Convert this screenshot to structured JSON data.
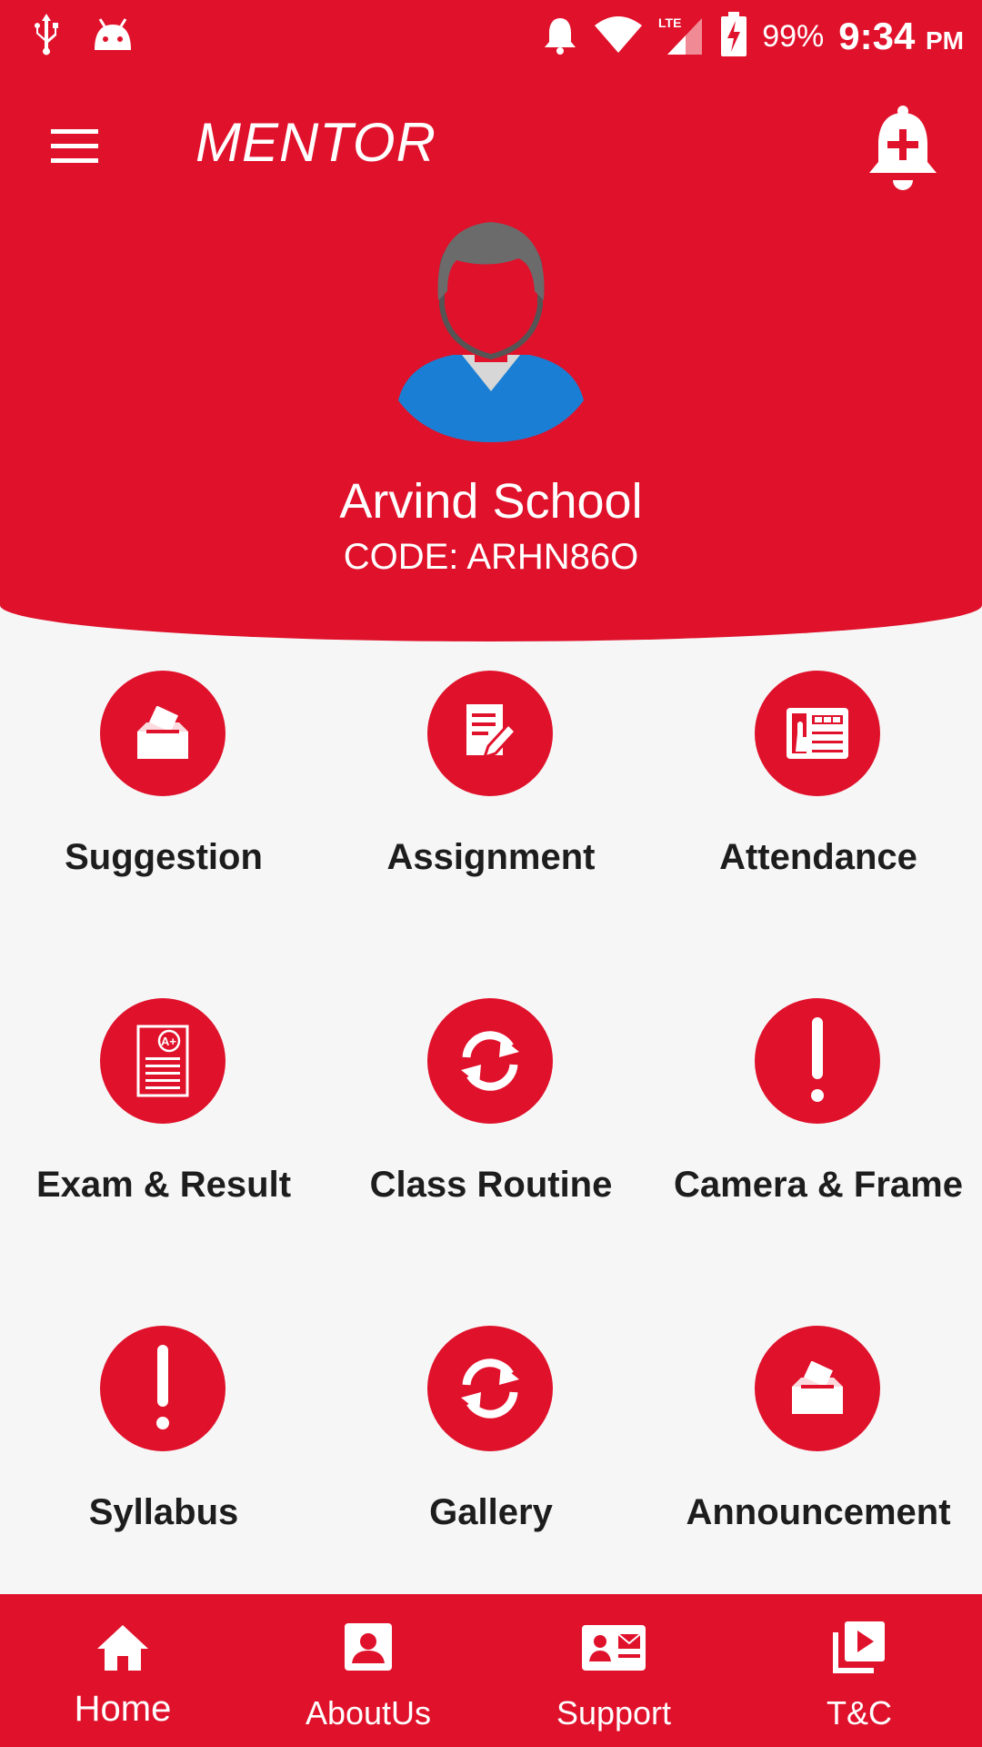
{
  "status_bar": {
    "battery": "99%",
    "time": "9:34",
    "ampm": "PM",
    "icons": [
      "usb-icon",
      "android-icon",
      "alarm-bell-icon",
      "wifi-icon",
      "lte-signal-icon",
      "battery-charging-icon"
    ]
  },
  "header": {
    "title": "MENTOR",
    "school_name": "Arvind School",
    "school_code": "CODE: ARHN86O"
  },
  "grid": [
    {
      "label": "Suggestion",
      "icon": "ballot-box-icon"
    },
    {
      "label": "Assignment",
      "icon": "edit-document-icon"
    },
    {
      "label": "Attendance",
      "icon": "attendance-machine-icon"
    },
    {
      "label": "Exam & Result",
      "icon": "grade-sheet-icon"
    },
    {
      "label": "Class Routine",
      "icon": "refresh-icon"
    },
    {
      "label": "Camera & Frame",
      "icon": "exclamation-icon"
    },
    {
      "label": "Syllabus",
      "icon": "exclamation-icon"
    },
    {
      "label": "Gallery",
      "icon": "refresh-icon"
    },
    {
      "label": "Announcement",
      "icon": "ballot-box-icon"
    }
  ],
  "bottom_nav": [
    {
      "label": "Home",
      "icon": "home-icon"
    },
    {
      "label": "AboutUs",
      "icon": "account-box-icon"
    },
    {
      "label": "Support",
      "icon": "contact-mail-icon"
    },
    {
      "label": "T&C",
      "icon": "video-library-icon"
    }
  ],
  "colors": {
    "primary": "#e0112b",
    "background": "#f6f6f6",
    "text": "#1d1d1d"
  }
}
